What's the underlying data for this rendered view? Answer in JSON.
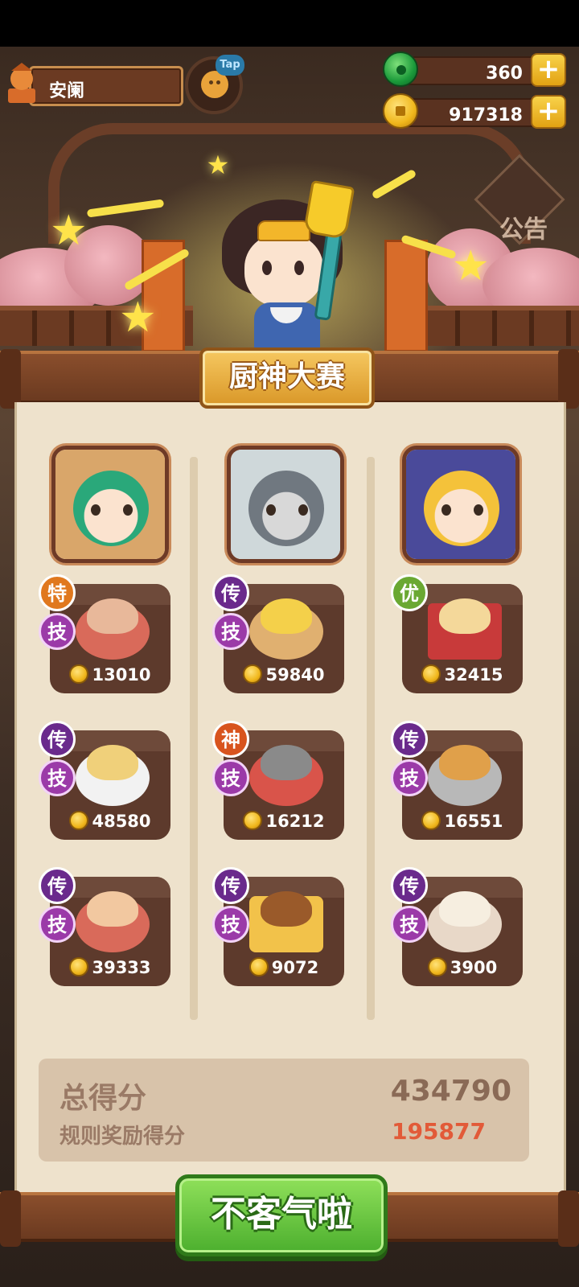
{
  "player": {
    "name": "安阑",
    "tap_badge": "Tap"
  },
  "currencies": [
    {
      "name": "jade",
      "value": "360"
    },
    {
      "name": "coin",
      "value": "917318"
    }
  ],
  "notice_label": "公告",
  "contest": {
    "title": "厨神大赛",
    "columns": [
      {
        "chef": "green-haired-chef",
        "dishes": [
          {
            "rank": "特",
            "skill": "技",
            "price": "13010"
          },
          {
            "rank": "传",
            "skill": "技",
            "price": "48580"
          },
          {
            "rank": "传",
            "skill": "技",
            "price": "39333"
          }
        ]
      },
      {
        "chef": "wolf-chef",
        "dishes": [
          {
            "rank": "传",
            "skill": "技",
            "price": "59840"
          },
          {
            "rank": "神",
            "skill": "技",
            "price": "16212"
          },
          {
            "rank": "传",
            "skill": "技",
            "price": "9072"
          }
        ]
      },
      {
        "chef": "cat-chef",
        "dishes": [
          {
            "rank": "优",
            "skill": "技",
            "price": "32415"
          },
          {
            "rank": "传",
            "skill": "技",
            "price": "16551"
          },
          {
            "rank": "传",
            "skill": "技",
            "price": "3900"
          }
        ]
      }
    ],
    "total_label": "总得分",
    "total_value": "434790",
    "bonus_label": "规则奖励得分",
    "bonus_value": "195877"
  },
  "confirm_button": "不客气啦",
  "colors": {
    "accent_green": "#4caf2e",
    "gold": "#f0b71c",
    "bonus_red": "#e25a38"
  }
}
